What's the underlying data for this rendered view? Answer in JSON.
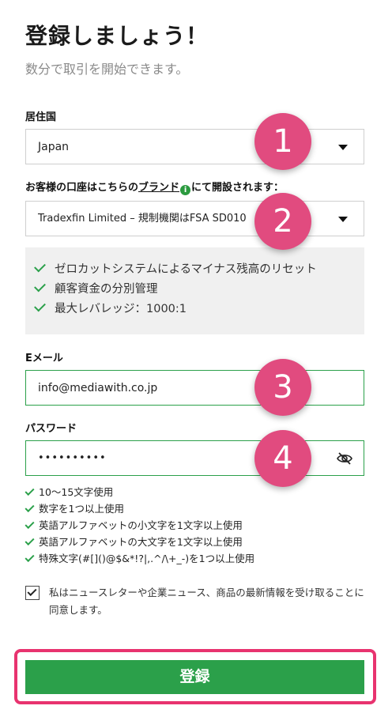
{
  "header": {
    "title": "登録しましょう！",
    "subtitle": "数分で取引を開始できます。"
  },
  "residence": {
    "label": "居住国",
    "value": "Japan"
  },
  "brand": {
    "label_prefix": "お客様の口座はこちらの",
    "label_link": "ブランド",
    "info_icon_glyph": "i",
    "label_suffix": "にて開設されます：",
    "value": "Tradexfin Limited – 規制機関はFSA SD010"
  },
  "features": [
    "ゼロカットシステムによるマイナス残高のリセット",
    "顧客資金の分別管理",
    "最大レバレッジ：1000:1"
  ],
  "email": {
    "label": "Eメール",
    "value": "info@mediawith.co.jp"
  },
  "password": {
    "label": "パスワード",
    "value": "••••••••••",
    "toggle_icon": "eye-slash-icon"
  },
  "password_rules": [
    "10～15文字使用",
    "数字を1つ以上使用",
    "英語アルファベットの小文字を1文字以上使用",
    "英語アルファベットの大文字を1文字以上使用",
    "特殊文字(#[]()@$&*!?|,.^/\\+_-)を1つ以上使用"
  ],
  "consent": {
    "checked": true,
    "text": "私はニュースレターや企業ニュース、商品の最新情報を受け取ることに同意します。"
  },
  "submit_label": "登録",
  "badges": [
    "1",
    "2",
    "3",
    "4"
  ],
  "colors": {
    "accent_green": "#2ba04a",
    "badge_pink": "#e14b7f",
    "highlight_pink": "#e8336f"
  }
}
